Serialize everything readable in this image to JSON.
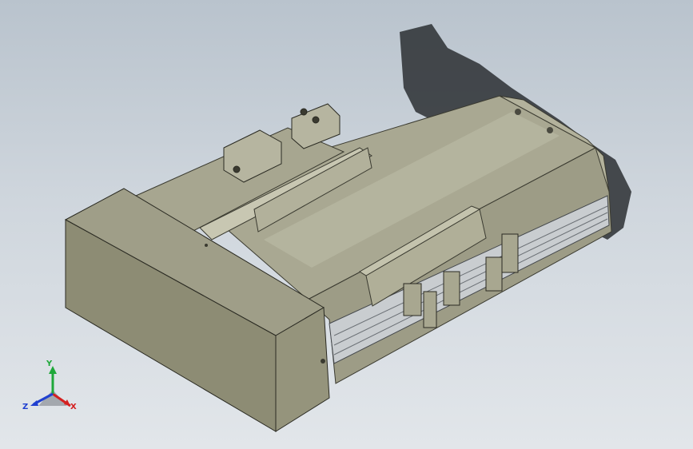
{
  "viewport": {
    "background_top": "#b9c3cd",
    "background_bottom": "#e2e6ea"
  },
  "model": {
    "body_color": "#a3a28a",
    "motor_housing_color": "#8d8c74",
    "rail_color": "#c9cdd0",
    "shadow_color": "#2b2f33"
  },
  "triad": {
    "x_label": "X",
    "y_label": "Y",
    "z_label": "Z",
    "x_color": "#d42020",
    "y_color": "#1fa83a",
    "z_color": "#2040d0"
  }
}
